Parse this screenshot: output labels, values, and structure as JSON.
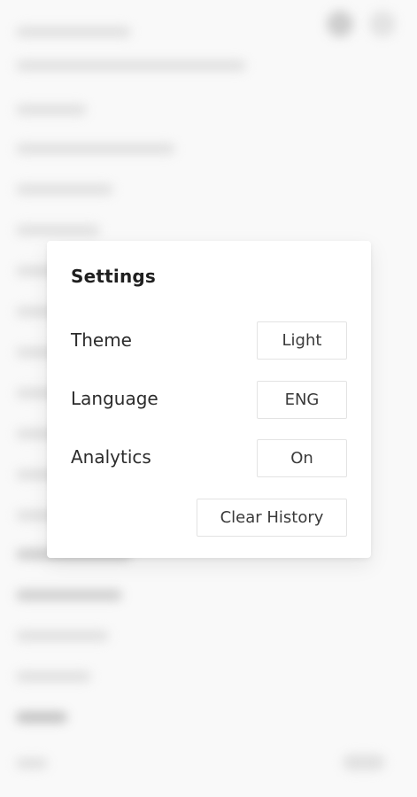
{
  "settings": {
    "title": "Settings",
    "rows": [
      {
        "label": "Theme",
        "value": "Light"
      },
      {
        "label": "Language",
        "value": "ENG"
      },
      {
        "label": "Analytics",
        "value": "On"
      }
    ],
    "clear_history_label": "Clear History"
  }
}
